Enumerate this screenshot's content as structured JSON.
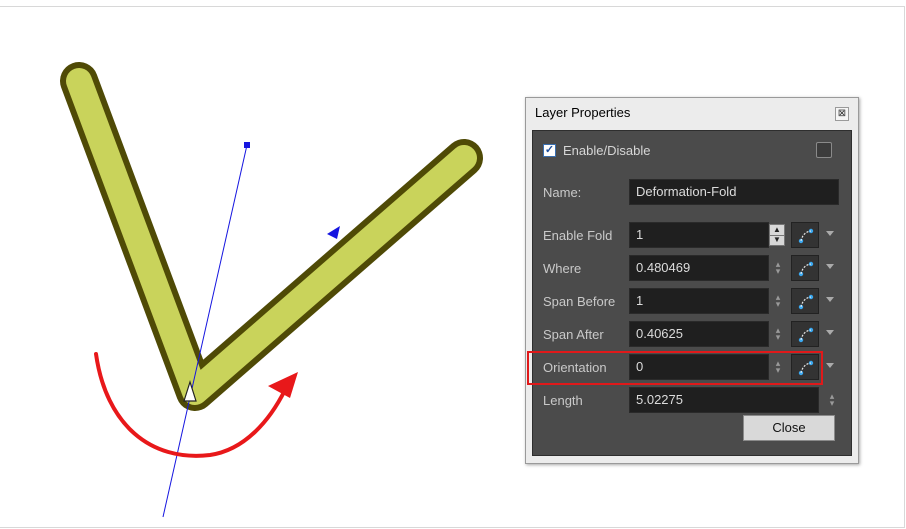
{
  "dialog": {
    "title": "Layer Properties",
    "close_glyph": "⊠",
    "enable": {
      "label": "Enable/Disable",
      "checked": true
    },
    "fields": [
      {
        "label": "Name:",
        "value": "Deformation-Fold"
      },
      {
        "label": "Enable Fold",
        "value": "1"
      },
      {
        "label": "Where",
        "value": "0.480469"
      },
      {
        "label": "Span Before",
        "value": "1"
      },
      {
        "label": "Span After",
        "value": "0.40625"
      },
      {
        "label": "Orientation",
        "value": "0"
      },
      {
        "label": "Length",
        "value": "5.02275"
      }
    ],
    "close_button": "Close"
  },
  "colors": {
    "stroke_fill": "#c9d35b",
    "stroke_outline": "#4f4a06",
    "deformer_line": "#1515e0",
    "rotation_arrow": "#e8181a",
    "highlight_box": "#e0191a"
  },
  "icons": {
    "function_button": "function-curve-icon",
    "dropdown": "chevron-down-icon",
    "spinner": "spinner-arrows-icon"
  }
}
